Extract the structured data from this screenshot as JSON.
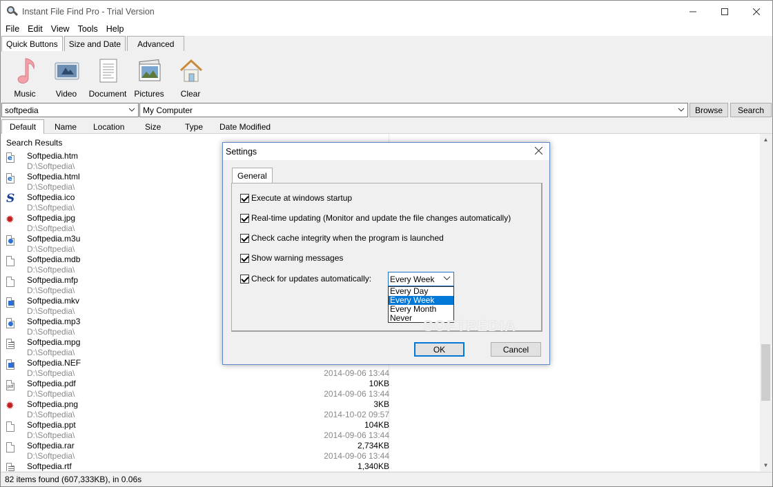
{
  "window": {
    "title": "Instant File Find Pro - Trial Version"
  },
  "menu": [
    "File",
    "Edit",
    "View",
    "Tools",
    "Help"
  ],
  "top_tabs": [
    "Quick Buttons",
    "Size and Date",
    "Advanced"
  ],
  "quick_buttons": [
    {
      "label": "Music",
      "icon": "music-note-icon"
    },
    {
      "label": "Video",
      "icon": "video-icon"
    },
    {
      "label": "Document",
      "icon": "document-icon"
    },
    {
      "label": "Pictures",
      "icon": "pictures-icon"
    },
    {
      "label": "Clear",
      "icon": "house-icon"
    }
  ],
  "search": {
    "query": "softpedia",
    "location": "My Computer",
    "browse_label": "Browse",
    "search_label": "Search"
  },
  "columns": [
    "Default",
    "Name",
    "Location",
    "Size",
    "Type",
    "Date Modified"
  ],
  "results": {
    "group_title": "Search Results",
    "items": [
      {
        "name": "Softpedia.htm",
        "path": "D:\\Softpedia\\",
        "size": "",
        "date": "",
        "icon": "ie-file-icon"
      },
      {
        "name": "Softpedia.html",
        "path": "D:\\Softpedia\\",
        "size": "",
        "date": "",
        "icon": "ie-file-icon"
      },
      {
        "name": "Softpedia.ico",
        "path": "D:\\Softpedia\\",
        "size": "",
        "date": "",
        "icon": "softpedia-logo-icon"
      },
      {
        "name": "Softpedia.jpg",
        "path": "D:\\Softpedia\\",
        "size": "",
        "date": "",
        "icon": "splat-image-icon"
      },
      {
        "name": "Softpedia.m3u",
        "path": "D:\\Softpedia\\",
        "size": "",
        "date": "",
        "icon": "media-file-icon"
      },
      {
        "name": "Softpedia.mdb",
        "path": "D:\\Softpedia\\",
        "size": "",
        "date": "",
        "icon": "blank-file-icon"
      },
      {
        "name": "Softpedia.mfp",
        "path": "D:\\Softpedia\\",
        "size": "",
        "date": "",
        "icon": "blank-file-icon"
      },
      {
        "name": "Softpedia.mkv",
        "path": "D:\\Softpedia\\",
        "size": "",
        "date": "",
        "icon": "video-file-icon"
      },
      {
        "name": "Softpedia.mp3",
        "path": "D:\\Softpedia\\",
        "size": "",
        "date": "",
        "icon": "media-file-icon"
      },
      {
        "name": "Softpedia.mpg",
        "path": "D:\\Softpedia\\",
        "size": "",
        "date": "",
        "icon": "text-file-icon"
      },
      {
        "name": "Softpedia.NEF",
        "path": "D:\\Softpedia\\",
        "size": "",
        "date": "2014-09-06 13:44",
        "icon": "image-file-icon"
      },
      {
        "name": "Softpedia.pdf",
        "path": "D:\\Softpedia\\",
        "size": "10KB",
        "date": "2014-09-06 13:44",
        "icon": "pdf-file-icon"
      },
      {
        "name": "Softpedia.png",
        "path": "D:\\Softpedia\\",
        "size": "3KB",
        "date": "2014-10-02 09:57",
        "icon": "splat-image-icon"
      },
      {
        "name": "Softpedia.ppt",
        "path": "D:\\Softpedia\\",
        "size": "104KB",
        "date": "2014-09-06 13:44",
        "icon": "blank-file-icon"
      },
      {
        "name": "Softpedia.rar",
        "path": "D:\\Softpedia\\",
        "size": "2,734KB",
        "date": "2014-09-06 13:44",
        "icon": "blank-file-icon"
      },
      {
        "name": "Softpedia.rtf",
        "path": "",
        "size": "1,340KB",
        "date": "",
        "icon": "text-file-icon"
      }
    ]
  },
  "status": "82 items found (607,333KB), in 0.06s",
  "settings_dialog": {
    "title": "Settings",
    "tab": "General",
    "options": [
      {
        "label": "Execute at windows startup",
        "checked": true
      },
      {
        "label": "Real-time updating (Monitor and update the file changes automatically)",
        "checked": true
      },
      {
        "label": "Check cache integrity when the program is launched",
        "checked": true
      },
      {
        "label": "Show warning messages",
        "checked": true
      },
      {
        "label": "Check for updates automatically:",
        "checked": true
      }
    ],
    "update_frequency": {
      "selected": "Every Week",
      "options": [
        "Every Day",
        "Every Week",
        "Every Month",
        "Never"
      ]
    },
    "ok_label": "OK",
    "cancel_label": "Cancel",
    "watermark": "SOFTPEDIA"
  }
}
